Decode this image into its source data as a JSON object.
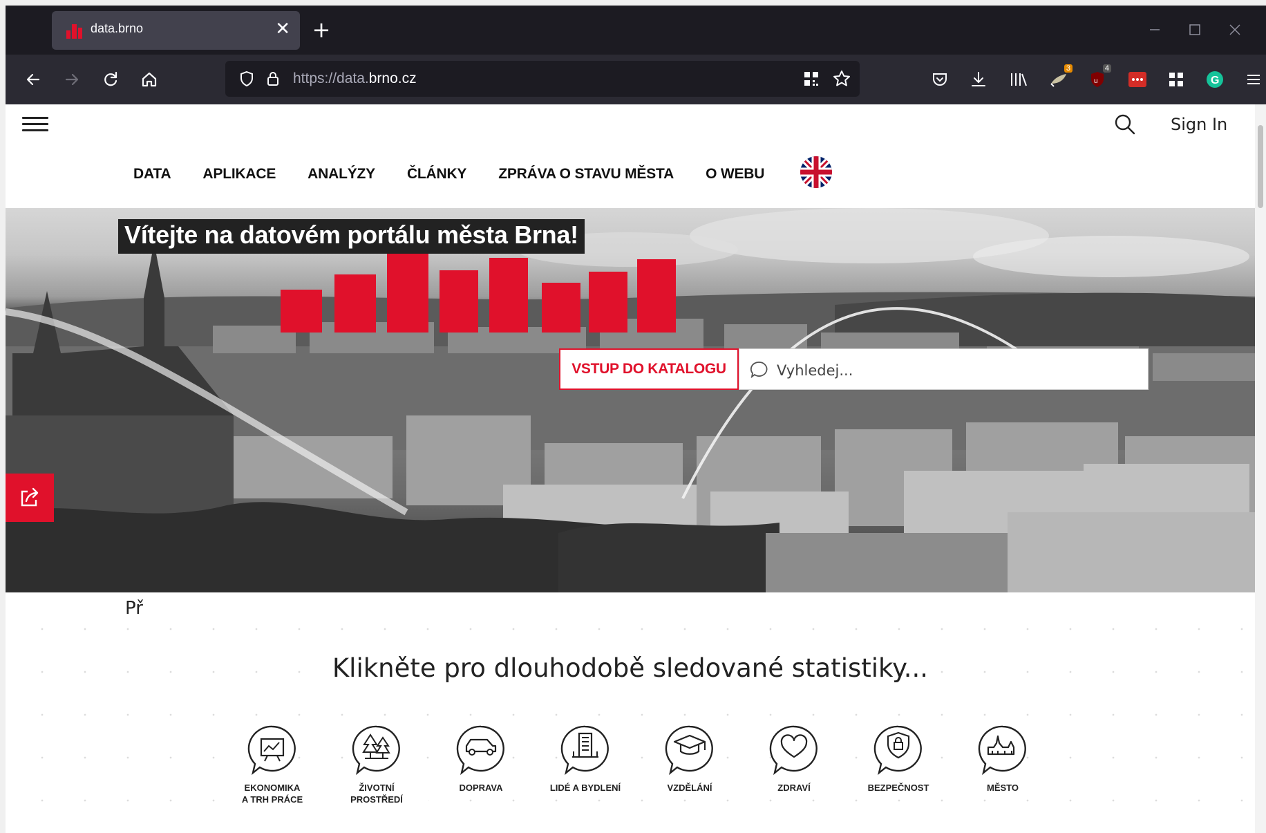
{
  "browser": {
    "tab_title": "data.brno",
    "url_prefix": "https://data.",
    "url_domain": "brno.cz",
    "badges": {
      "ext1": "3",
      "ext2": "4"
    }
  },
  "header": {
    "sign_in": "Sign In"
  },
  "nav": {
    "items": [
      "DATA",
      "APLIKACE",
      "ANALÝZY",
      "ČLÁNKY",
      "ZPRÁVA O STAVU MĚSTA",
      "O WEBU"
    ]
  },
  "hero": {
    "title": "Vítejte na datovém portálu města Brna!",
    "catalog_button": "VSTUP DO KATALOGU",
    "search_placeholder": "Vyhledej...",
    "accent_color": "#e0112b"
  },
  "content": {
    "cut_text": "Př",
    "stats_heading": "Klikněte pro dlouhodobě sledované statistiky...",
    "categories": [
      {
        "label": "EKONOMIKA\nA TRH PRÁCE",
        "icon": "chart-board-icon"
      },
      {
        "label": "ŽIVOTNÍ\nPROSTŘEDÍ",
        "icon": "trees-icon"
      },
      {
        "label": "DOPRAVA",
        "icon": "car-icon"
      },
      {
        "label": "LIDÉ A BYDLENÍ",
        "icon": "building-icon"
      },
      {
        "label": "VZDĚLÁNÍ",
        "icon": "graduation-cap-icon"
      },
      {
        "label": "ZDRAVÍ",
        "icon": "heart-icon"
      },
      {
        "label": "BEZPEČNOST",
        "icon": "shield-icon"
      },
      {
        "label": "MĚSTO",
        "icon": "castle-icon"
      }
    ]
  }
}
